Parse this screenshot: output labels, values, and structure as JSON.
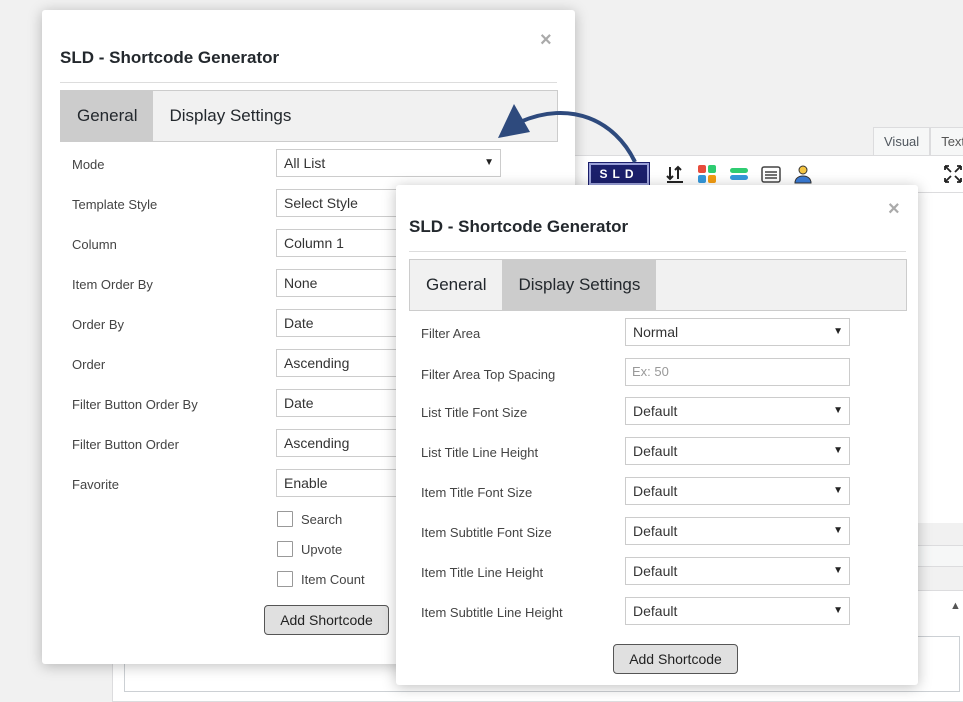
{
  "editor": {
    "tab_visual": "Visual",
    "tab_text": "Text",
    "sld_button": "SLD"
  },
  "dialog1": {
    "title": "SLD - Shortcode Generator",
    "close": "×",
    "tabs": [
      {
        "label": "General",
        "active": true
      },
      {
        "label": "Display Settings",
        "active": false
      }
    ],
    "rows": [
      {
        "label": "Mode",
        "value": "All List"
      },
      {
        "label": "Template Style",
        "value": "Select Style"
      },
      {
        "label": "Column",
        "value": "Column 1"
      },
      {
        "label": "Item Order By",
        "value": "None"
      },
      {
        "label": "Order By",
        "value": "Date"
      },
      {
        "label": "Order",
        "value": "Ascending"
      },
      {
        "label": "Filter Button Order By",
        "value": "Date"
      },
      {
        "label": "Filter Button Order",
        "value": "Ascending"
      },
      {
        "label": "Favorite",
        "value": "Enable"
      }
    ],
    "checkboxes": [
      "Search",
      "Upvote",
      "Item Count"
    ],
    "add_button": "Add Shortcode"
  },
  "dialog2": {
    "title": "SLD - Shortcode Generator",
    "close": "×",
    "tabs": [
      {
        "label": "General",
        "active": false
      },
      {
        "label": "Display Settings",
        "active": true
      }
    ],
    "filter_area": {
      "label": "Filter Area",
      "value": "Normal"
    },
    "filter_spacing": {
      "label": "Filter Area Top Spacing",
      "placeholder": "Ex: 50"
    },
    "rows": [
      {
        "label": "List Title Font Size",
        "value": "Default"
      },
      {
        "label": "List Title Line Height",
        "value": "Default"
      },
      {
        "label": "Item Title Font Size",
        "value": "Default"
      },
      {
        "label": "Item Subtitle Font Size",
        "value": "Default"
      },
      {
        "label": "Item Title Line Height",
        "value": "Default"
      },
      {
        "label": "Item Subtitle Line Height",
        "value": "Default"
      }
    ],
    "add_button": "Add Shortcode"
  },
  "colors": {
    "arrow": "#2e4a7d",
    "sld_bg": "#1b1f6b",
    "active_tab": "#cccccc"
  }
}
